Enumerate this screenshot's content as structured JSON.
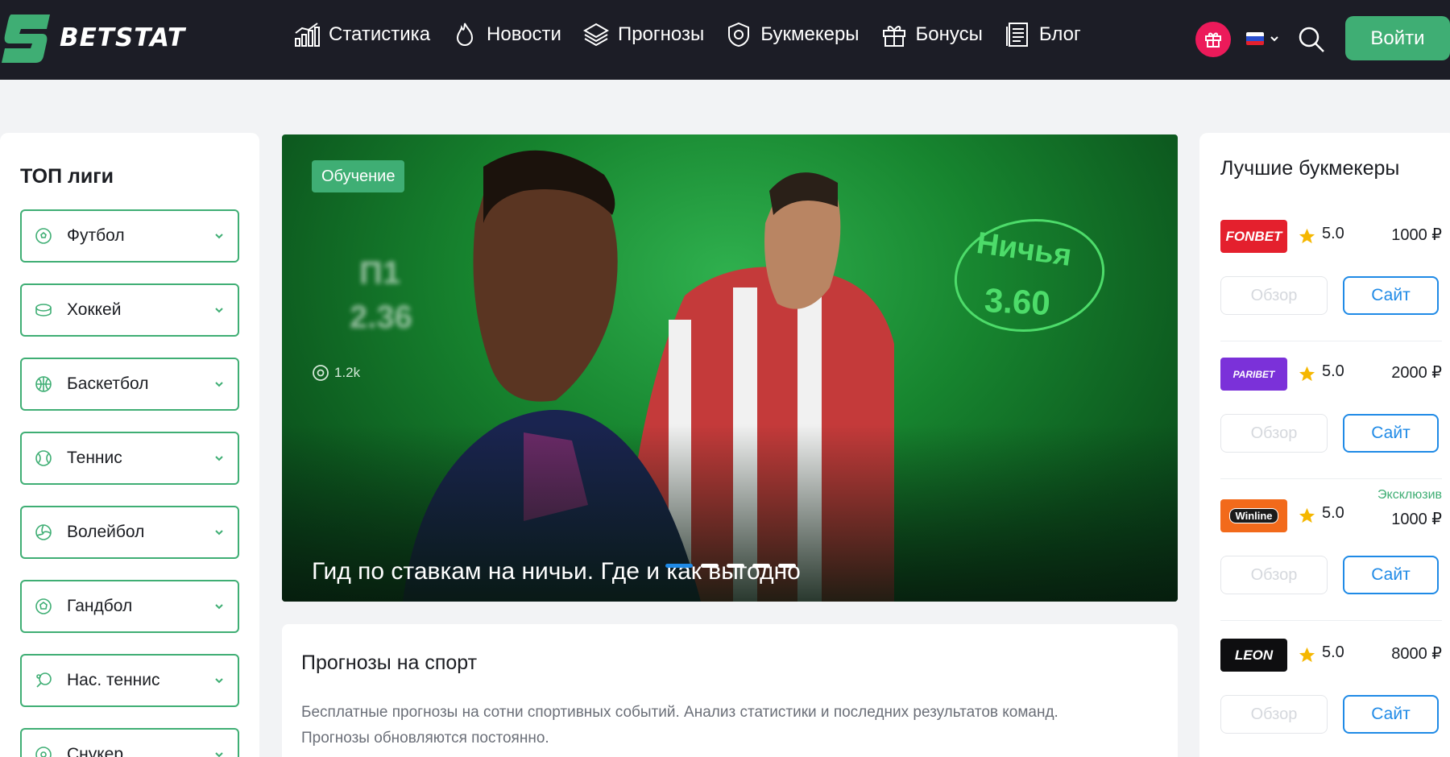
{
  "header": {
    "logo_text": "BETSTAT",
    "nav": [
      {
        "label": "Статистика",
        "icon": "chart-icon"
      },
      {
        "label": "Новости",
        "icon": "fire-icon"
      },
      {
        "label": "Прогнозы",
        "icon": "layers-icon"
      },
      {
        "label": "Букмекеры",
        "icon": "badge-icon"
      },
      {
        "label": "Бонусы",
        "icon": "gift-icon"
      },
      {
        "label": "Блог",
        "icon": "document-icon"
      }
    ],
    "login_label": "Войти",
    "language": "ru",
    "colors": {
      "bg": "#1c1d26",
      "accent": "#3fae74",
      "gift": "#ec1a5a"
    }
  },
  "left": {
    "title": "ТОП лиги",
    "leagues": [
      {
        "label": "Футбол",
        "icon": "football-icon"
      },
      {
        "label": "Хоккей",
        "icon": "hockey-puck-icon"
      },
      {
        "label": "Баскетбол",
        "icon": "basketball-icon"
      },
      {
        "label": "Теннис",
        "icon": "tennis-ball-icon"
      },
      {
        "label": "Волейбол",
        "icon": "volleyball-icon"
      },
      {
        "label": "Гандбол",
        "icon": "handball-icon"
      },
      {
        "label": "Нас. теннис",
        "icon": "table-tennis-icon"
      },
      {
        "label": "Снукер",
        "icon": "snooker-icon"
      }
    ]
  },
  "hero": {
    "tag": "Обучение",
    "views": "1.2k",
    "title": "Гид по ставкам на ничьи. Где и как выгодно",
    "odds_left_label": "П1",
    "odds_left_value": "2.36",
    "draw_label": "Ничья",
    "draw_value": "3.60",
    "slides_total": 5,
    "slide_active": 1
  },
  "forecast": {
    "title": "Прогнозы на спорт",
    "text": "Бесплатные прогнозы на сотни спортивных событий. Анализ статистики и последних результатов команд. Прогнозы обновляются постоянно."
  },
  "right": {
    "title": "Лучшие букмекеры",
    "review_label": "Обзор",
    "site_label": "Сайт",
    "bookmakers": [
      {
        "name": "FONBET",
        "rating": "5.0",
        "bonus": "1000 ₽",
        "exclusive": "",
        "color": "#e4202d"
      },
      {
        "name": "PARIBET",
        "rating": "5.0",
        "bonus": "2000 ₽",
        "exclusive": "",
        "color": "#7b31d9"
      },
      {
        "name": "Winline",
        "rating": "5.0",
        "bonus": "1000 ₽",
        "exclusive": "Эксклюзив",
        "color": "#f26a1b"
      },
      {
        "name": "LEON",
        "rating": "5.0",
        "bonus": "8000 ₽",
        "exclusive": "",
        "color": "#0e0e10"
      }
    ]
  }
}
